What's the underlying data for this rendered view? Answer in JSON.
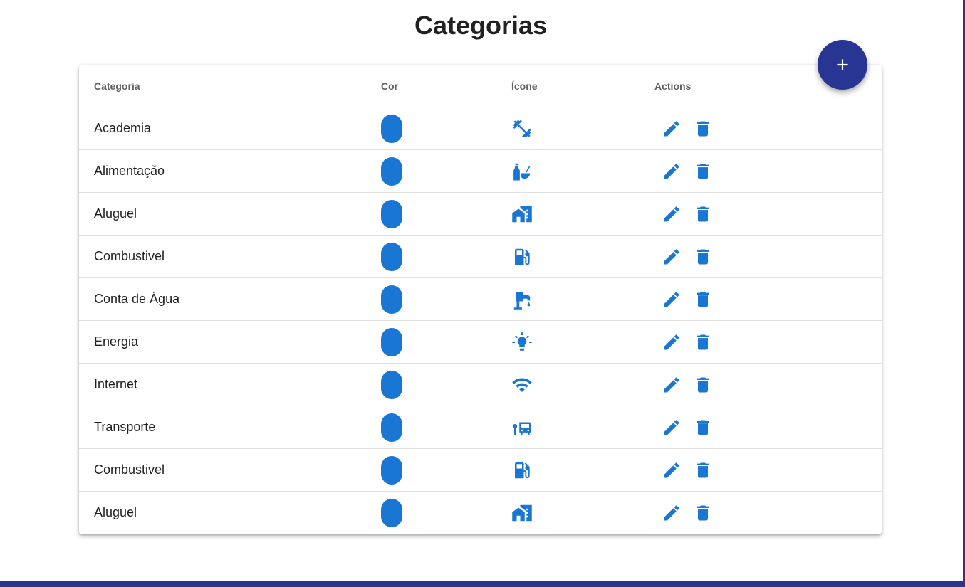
{
  "page": {
    "title": "Categorias",
    "accent_color": "#283593",
    "icon_color": "#1976d2"
  },
  "fab": {
    "icon": "add-icon"
  },
  "table": {
    "columns": [
      "Categoria",
      "Cor",
      "Ícone",
      "Actions"
    ],
    "rows": [
      {
        "name": "Academia",
        "color": "#1976d2",
        "icon": "fitness-icon"
      },
      {
        "name": "Alimentação",
        "color": "#1976d2",
        "icon": "restaurant-icon"
      },
      {
        "name": "Aluguel",
        "color": "#1976d2",
        "icon": "home-work-icon"
      },
      {
        "name": "Combustivel",
        "color": "#1976d2",
        "icon": "gas-station-icon"
      },
      {
        "name": "Conta de Água",
        "color": "#1976d2",
        "icon": "water-tap-icon"
      },
      {
        "name": "Energia",
        "color": "#1976d2",
        "icon": "lightbulb-icon"
      },
      {
        "name": "Internet",
        "color": "#1976d2",
        "icon": "wifi-icon"
      },
      {
        "name": "Transporte",
        "color": "#1976d2",
        "icon": "bus-stop-icon"
      },
      {
        "name": "Combustivel",
        "color": "#1976d2",
        "icon": "gas-station-icon"
      },
      {
        "name": "Aluguel",
        "color": "#1976d2",
        "icon": "home-work-icon"
      }
    ],
    "row_actions": [
      "edit-icon",
      "delete-icon"
    ]
  }
}
